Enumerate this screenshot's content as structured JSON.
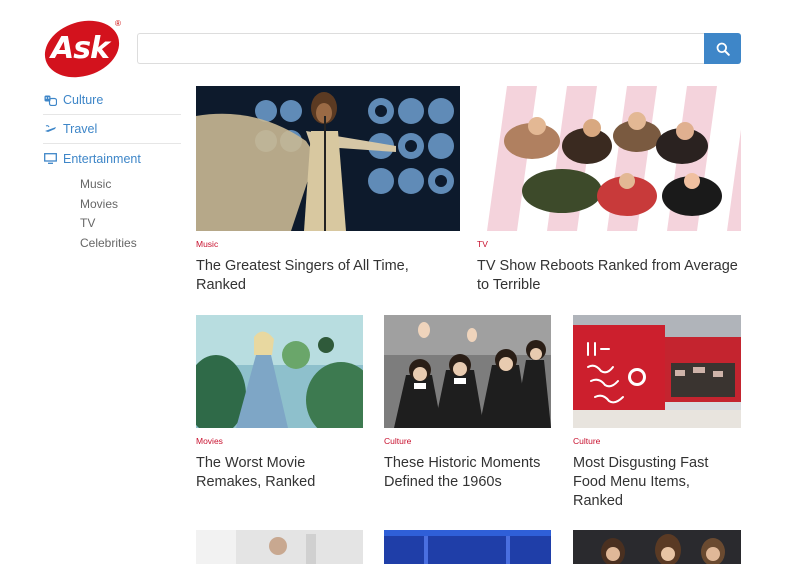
{
  "brand": {
    "logo_text": "Ask",
    "reg": "®"
  },
  "search": {
    "placeholder": "",
    "value": ""
  },
  "sidebar": {
    "categories": [
      {
        "label": "Culture",
        "icon": "theater-masks-icon"
      },
      {
        "label": "Travel",
        "icon": "airplane-icon"
      },
      {
        "label": "Entertainment",
        "icon": "monitor-icon"
      }
    ],
    "subcategories": [
      "Music",
      "Movies",
      "TV",
      "Celebrities"
    ]
  },
  "cards": [
    {
      "tag": "Music",
      "title": "The Greatest Singers of All Time, Ranked",
      "image": "singer-on-stage"
    },
    {
      "tag": "TV",
      "title": "TV Show Reboots Ranked from Average to Terrible",
      "image": "tv-cast-group"
    },
    {
      "tag": "Movies",
      "title": "The Worst Movie Remakes, Ranked",
      "image": "fantasy-movie-scene"
    },
    {
      "tag": "Culture",
      "title": "These Historic Moments Defined the 1960s",
      "image": "band-waving"
    },
    {
      "tag": "Culture",
      "title": "Most Disgusting Fast Food Menu Items, Ranked",
      "image": "restaurant-storefront"
    },
    {
      "tag": "",
      "title": "",
      "image": "partial-thumbnail-1"
    },
    {
      "tag": "",
      "title": "",
      "image": "partial-thumbnail-2"
    },
    {
      "tag": "",
      "title": "",
      "image": "partial-thumbnail-3"
    }
  ],
  "colors": {
    "accent": "#3e86c8",
    "brand_red": "#c8102e",
    "logo_red": "#d3121d"
  }
}
